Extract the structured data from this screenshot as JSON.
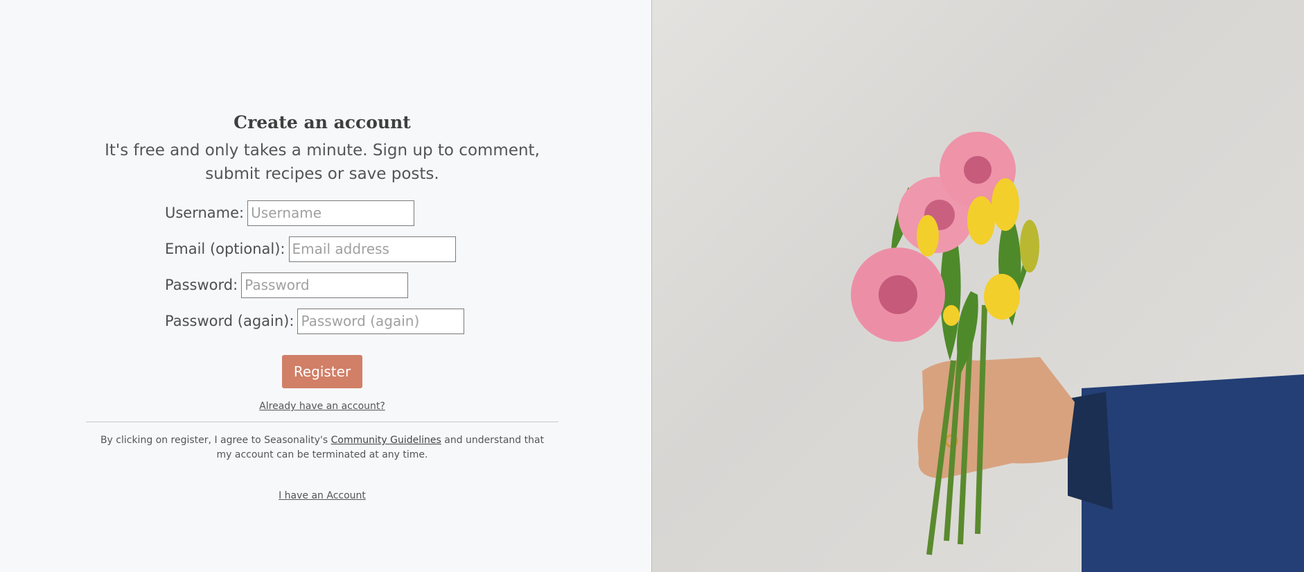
{
  "form": {
    "title": "Create an account",
    "subtitle": "It's free and only takes a minute. Sign up to comment, submit recipes or save posts.",
    "fields": [
      {
        "label": "Username:",
        "placeholder": "Username"
      },
      {
        "label": "Email (optional):",
        "placeholder": "Email address"
      },
      {
        "label": "Password:",
        "placeholder": "Password"
      },
      {
        "label": "Password (again):",
        "placeholder": "Password (again)"
      }
    ],
    "register_label": "Register",
    "login_link": "Already have an account?",
    "terms_prefix": "By clicking on register, I agree to Seasonality's ",
    "terms_link": "Community Guidelines",
    "terms_suffix": " and understand that my account can be terminated at any time.",
    "have_account_link": "I have an Account"
  },
  "colors": {
    "accent": "#d17f67",
    "background": "#f7f8fa"
  },
  "image": {
    "alt": "hand-holding-flower-bouquet"
  }
}
